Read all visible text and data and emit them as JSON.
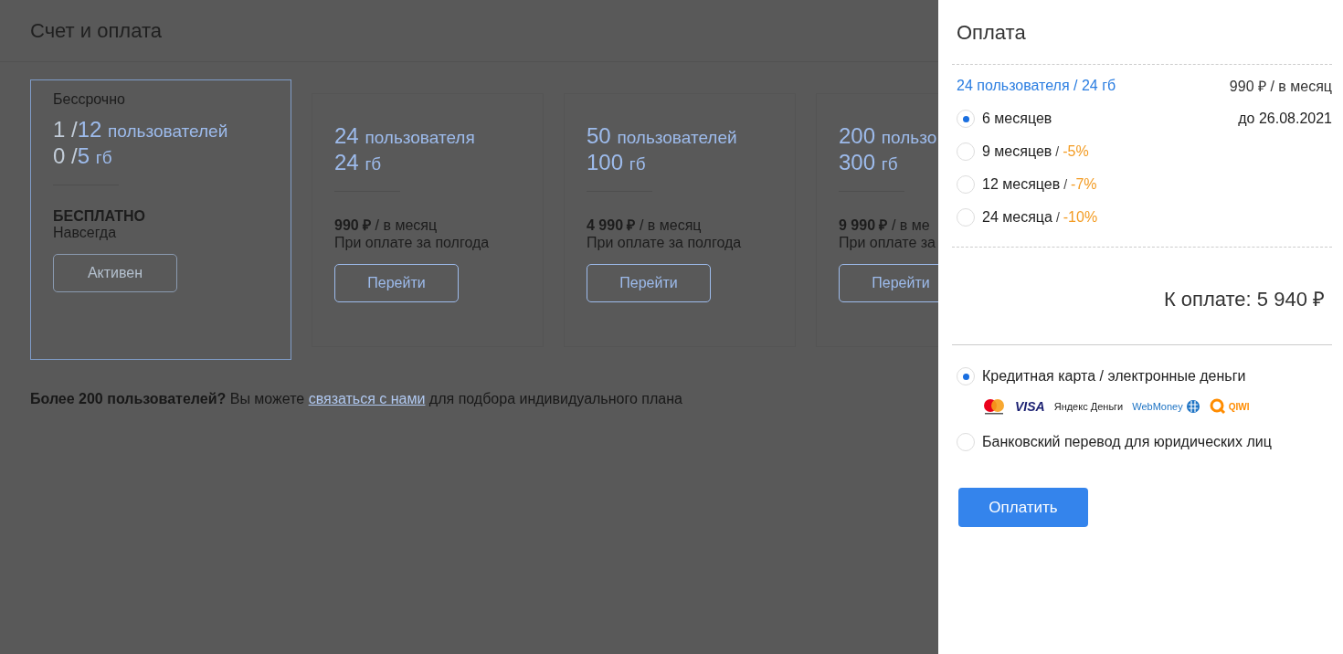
{
  "page": {
    "title": "Счет и оплата",
    "plans": [
      {
        "label": "Бессрочно",
        "current": true,
        "users": {
          "used": "1 /",
          "total": "12",
          "unit": "пользователей"
        },
        "storage": {
          "used": "0 /",
          "total": "5",
          "unit": "гб"
        },
        "price": "БЕСПЛАТНО",
        "price_bold": true,
        "note": "Навсегда",
        "button": "Активен"
      },
      {
        "current": false,
        "users": {
          "total": "24",
          "unit": "пользователя"
        },
        "storage": {
          "total": "24",
          "unit": "гб"
        },
        "price": "**990 ₽** / в месяц",
        "price_bold": false,
        "note": "При оплате за полгода",
        "button": "Перейти"
      },
      {
        "current": false,
        "users": {
          "total": "50",
          "unit": "пользователей"
        },
        "storage": {
          "total": "100",
          "unit": "гб"
        },
        "price": "**4 990 ₽** / в месяц",
        "price_bold": false,
        "note": "При оплате за полгода",
        "button": "Перейти"
      },
      {
        "current": false,
        "users": {
          "total": "200",
          "unit": "пользо"
        },
        "storage": {
          "total": "300",
          "unit": "гб"
        },
        "price": "**9 990 ₽** / в ме",
        "price_bold": false,
        "note": "При оплате за",
        "button": "Перейти"
      }
    ],
    "footer": {
      "before": "**Более 200 пользователей?** Вы можете ",
      "link": "связаться с нами",
      "after": " для подбора индивидуального плана"
    }
  },
  "payment": {
    "title": "Оплата",
    "plan_name": "24 пользователя / 24 гб",
    "plan_price": "990 ₽ / в месяц",
    "periods": [
      {
        "label": "6 месяцев",
        "selected": true,
        "until": "до 26.08.2021"
      },
      {
        "label": "9 месяцев",
        "selected": false,
        "separator": "/",
        "discount": "-5%"
      },
      {
        "label": "12 месяцев",
        "selected": false,
        "separator": "/",
        "discount": "-7%"
      },
      {
        "label": "24 месяца",
        "selected": false,
        "separator": "/",
        "discount": "-10%"
      }
    ],
    "total": "К оплате: 5 940 ₽",
    "methods": [
      {
        "label": "Кредитная карта / электронные деньги",
        "selected": true,
        "logos": [
          {
            "kind": "mastercard"
          },
          {
            "kind": "visa",
            "text": "VISA"
          },
          {
            "kind": "yandex",
            "text": "Яндекс Деньги"
          },
          {
            "kind": "webmoney",
            "text": "WebMoney"
          },
          {
            "kind": "qiwi",
            "text": "QIWI"
          }
        ]
      },
      {
        "label": "Банковский перевод для юридических лиц",
        "selected": false
      }
    ],
    "pay_button": "Оплатить"
  }
}
